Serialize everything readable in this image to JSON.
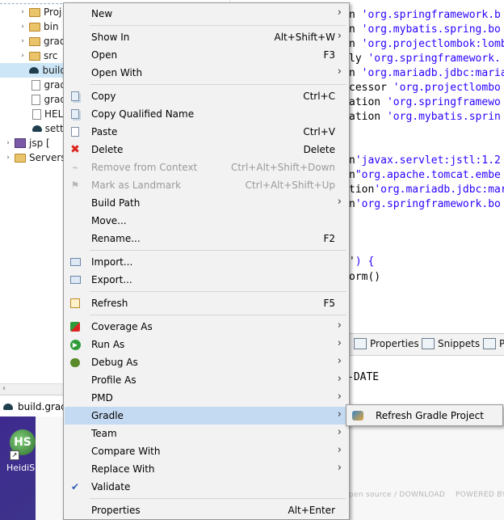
{
  "explorer": {
    "rows": [
      {
        "label": "Proj",
        "icon": "folder-icon",
        "twisty": "›"
      },
      {
        "label": "bin",
        "icon": "folder-icon",
        "twisty": "›"
      },
      {
        "label": "grad",
        "icon": "folder-icon",
        "twisty": "›"
      },
      {
        "label": "src",
        "icon": "folder-icon",
        "twisty": "›"
      },
      {
        "label": "build",
        "icon": "gradle-file-icon",
        "twisty": ""
      },
      {
        "label": "grad",
        "icon": "file-icon",
        "twisty": ""
      },
      {
        "label": "grad",
        "icon": "file-icon",
        "twisty": ""
      },
      {
        "label": "HEL",
        "icon": "file-icon",
        "twisty": ""
      },
      {
        "label": "setti",
        "icon": "gradle-file-icon",
        "twisty": ""
      },
      {
        "label": "jsp [",
        "icon": "project-icon",
        "twisty": "›"
      },
      {
        "label": "Servers",
        "icon": "folder-icon",
        "twisty": "›"
      }
    ],
    "scroll_left": "‹"
  },
  "editor": {
    "lines": [
      {
        "pre": "n ",
        "str": "'org.springframework.b"
      },
      {
        "pre": "n ",
        "str": "'org.mybatis.spring.bo"
      },
      {
        "pre": "n ",
        "str": "'org.projectlombok:lombok"
      },
      {
        "pre": "ly ",
        "str": "'org.springframework."
      },
      {
        "pre": "n ",
        "str": "'org.mariadb.jdbc:mariadb"
      },
      {
        "pre": "cessor ",
        "str": "'org.projectlombo"
      },
      {
        "pre": "ation ",
        "str": "'org.springframewo"
      },
      {
        "pre": "ation ",
        "str": "'org.mybatis.sprin"
      },
      {
        "pre": "n",
        "str": "'javax.servlet:jstl:1.2"
      },
      {
        "pre": "n",
        "str": "\"org.apache.tomcat.embe"
      },
      {
        "pre": "tion",
        "str": "'org.mariadb.jdbc:mar"
      },
      {
        "pre": "n",
        "str": "'org.springframework.bo"
      },
      {
        "pre": "'",
        "str": ") {"
      },
      {
        "pre": "orm()",
        "str": ""
      }
    ]
  },
  "views": {
    "tabs": [
      {
        "label": "Properties",
        "icon": "properties-icon"
      },
      {
        "label": "Snippets",
        "icon": "snippets-icon"
      },
      {
        "label": "Pr",
        "icon": "progress-icon"
      }
    ],
    "console_text": "-DATE"
  },
  "build_tab": {
    "label": "build.gradl"
  },
  "desktop": {
    "app_icon_text": "HS",
    "app_label": "HeidiS",
    "footer_left": "pen source / DOWNLOAD",
    "footer_right": "POWERED BY"
  },
  "context_menu": {
    "items": [
      {
        "label": "New",
        "shortcut": "",
        "submenu": true,
        "disabled": false,
        "icon": ""
      },
      {
        "label": "Show In",
        "shortcut": "Alt+Shift+W",
        "submenu": true,
        "disabled": false,
        "icon": ""
      },
      {
        "label": "Open",
        "shortcut": "F3",
        "submenu": false,
        "disabled": false,
        "icon": ""
      },
      {
        "label": "Open With",
        "shortcut": "",
        "submenu": true,
        "disabled": false,
        "icon": ""
      },
      {
        "label": "Copy",
        "shortcut": "Ctrl+C",
        "submenu": false,
        "disabled": false,
        "icon": "copy-icon"
      },
      {
        "label": "Copy Qualified Name",
        "shortcut": "",
        "submenu": false,
        "disabled": false,
        "icon": "copy-qualified-name-icon"
      },
      {
        "label": "Paste",
        "shortcut": "Ctrl+V",
        "submenu": false,
        "disabled": false,
        "icon": "paste-icon"
      },
      {
        "label": "Delete",
        "shortcut": "Delete",
        "submenu": false,
        "disabled": false,
        "icon": "delete-icon"
      },
      {
        "label": "Remove from Context",
        "shortcut": "Ctrl+Alt+Shift+Down",
        "submenu": false,
        "disabled": true,
        "icon": "remove-context-icon"
      },
      {
        "label": "Mark as Landmark",
        "shortcut": "Ctrl+Alt+Shift+Up",
        "submenu": false,
        "disabled": true,
        "icon": "landmark-icon"
      },
      {
        "label": "Build Path",
        "shortcut": "",
        "submenu": true,
        "disabled": false,
        "icon": ""
      },
      {
        "label": "Move...",
        "shortcut": "",
        "submenu": false,
        "disabled": false,
        "icon": ""
      },
      {
        "label": "Rename...",
        "shortcut": "F2",
        "submenu": false,
        "disabled": false,
        "icon": ""
      },
      {
        "label": "Import...",
        "shortcut": "",
        "submenu": false,
        "disabled": false,
        "icon": "import-icon"
      },
      {
        "label": "Export...",
        "shortcut": "",
        "submenu": false,
        "disabled": false,
        "icon": "export-icon"
      },
      {
        "label": "Refresh",
        "shortcut": "F5",
        "submenu": false,
        "disabled": false,
        "icon": "refresh-icon"
      },
      {
        "label": "Coverage As",
        "shortcut": "",
        "submenu": true,
        "disabled": false,
        "icon": "coverage-icon"
      },
      {
        "label": "Run As",
        "shortcut": "",
        "submenu": true,
        "disabled": false,
        "icon": "run-icon"
      },
      {
        "label": "Debug As",
        "shortcut": "",
        "submenu": true,
        "disabled": false,
        "icon": "debug-icon"
      },
      {
        "label": "Profile As",
        "shortcut": "",
        "submenu": true,
        "disabled": false,
        "icon": ""
      },
      {
        "label": "PMD",
        "shortcut": "",
        "submenu": true,
        "disabled": false,
        "icon": ""
      },
      {
        "label": "Gradle",
        "shortcut": "",
        "submenu": true,
        "disabled": false,
        "icon": "",
        "highlighted": true
      },
      {
        "label": "Team",
        "shortcut": "",
        "submenu": true,
        "disabled": false,
        "icon": ""
      },
      {
        "label": "Compare With",
        "shortcut": "",
        "submenu": true,
        "disabled": false,
        "icon": ""
      },
      {
        "label": "Replace With",
        "shortcut": "",
        "submenu": true,
        "disabled": false,
        "icon": ""
      },
      {
        "label": "Validate",
        "shortcut": "",
        "submenu": false,
        "disabled": false,
        "icon": "validate-check-icon"
      },
      {
        "label": "Properties",
        "shortcut": "Alt+Enter",
        "submenu": false,
        "disabled": false,
        "icon": ""
      }
    ]
  },
  "gradle_submenu": {
    "items": [
      {
        "label": "Refresh Gradle Project",
        "icon": "refresh-gradle-icon"
      }
    ]
  },
  "colors": {
    "menu_bg": "#f2f2f2",
    "highlight": "#c4daf2",
    "string": "#2a00ff"
  }
}
